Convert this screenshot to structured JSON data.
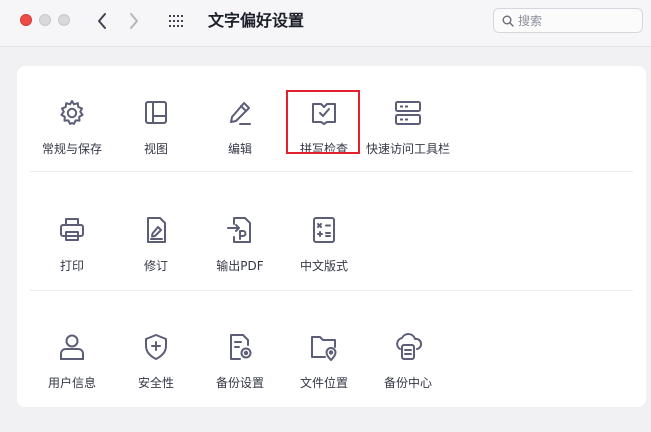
{
  "window": {
    "title": "文字偏好设置"
  },
  "search": {
    "placeholder": "搜索"
  },
  "rows": [
    [
      {
        "label": "常规与保存",
        "icon": "gear-icon"
      },
      {
        "label": "视图",
        "icon": "layout-icon"
      },
      {
        "label": "编辑",
        "icon": "pencil-icon"
      },
      {
        "label": "拼写检查",
        "icon": "spellcheck-book-icon",
        "selected": true
      },
      {
        "label": "快速访问工具栏",
        "icon": "toolbar-icon"
      }
    ],
    [
      {
        "label": "打印",
        "icon": "printer-icon"
      },
      {
        "label": "修订",
        "icon": "revise-document-icon"
      },
      {
        "label": "输出PDF",
        "icon": "export-pdf-icon"
      },
      {
        "label": "中文版式",
        "icon": "chinese-layout-icon"
      }
    ],
    [
      {
        "label": "用户信息",
        "icon": "user-icon"
      },
      {
        "label": "安全性",
        "icon": "shield-icon"
      },
      {
        "label": "备份设置",
        "icon": "backup-settings-icon"
      },
      {
        "label": "文件位置",
        "icon": "folder-location-icon"
      },
      {
        "label": "备份中心",
        "icon": "backup-center-icon"
      }
    ]
  ],
  "colors": {
    "icon": "#5b5e76",
    "selection": "#e1212d",
    "close": "#ec4b46"
  }
}
